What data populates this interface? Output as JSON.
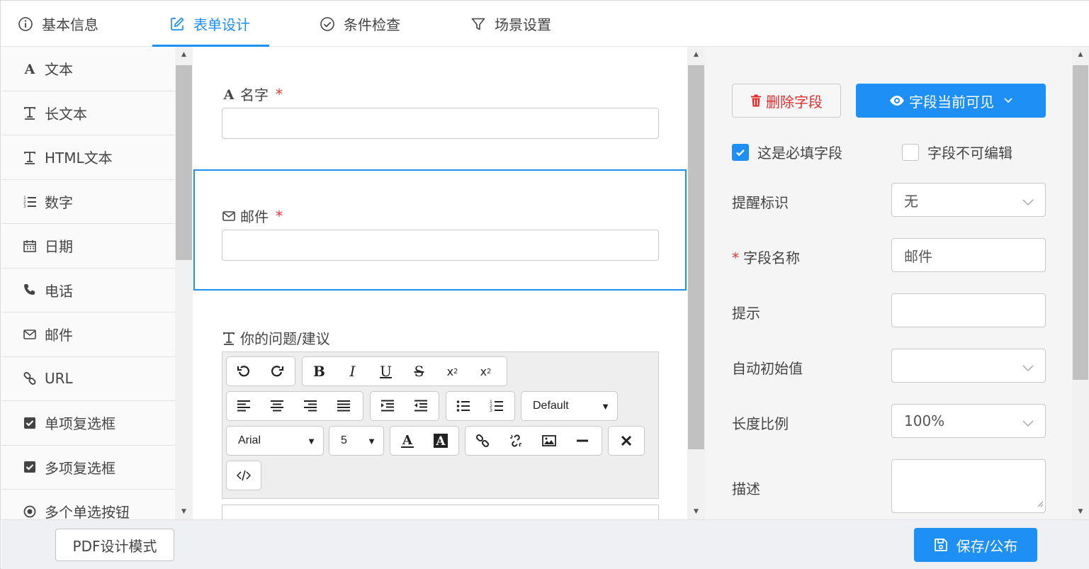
{
  "tabs": [
    {
      "label": "基本信息",
      "icon": "info-circle-icon"
    },
    {
      "label": "表单设计",
      "icon": "edit-icon",
      "active": true
    },
    {
      "label": "条件检查",
      "icon": "check-circle-icon"
    },
    {
      "label": "场景设置",
      "icon": "filter-icon"
    }
  ],
  "palette": {
    "items": [
      {
        "label": "文本",
        "icon": "font-a-icon"
      },
      {
        "label": "长文本",
        "icon": "text-t-icon"
      },
      {
        "label": "HTML文本",
        "icon": "text-t-icon"
      },
      {
        "label": "数字",
        "icon": "ordered-list-icon"
      },
      {
        "label": "日期",
        "icon": "calendar-icon"
      },
      {
        "label": "电话",
        "icon": "phone-icon"
      },
      {
        "label": "邮件",
        "icon": "envelope-icon"
      },
      {
        "label": "URL",
        "icon": "link-icon"
      },
      {
        "label": "单项复选框",
        "icon": "checkbox-icon"
      },
      {
        "label": "多项复选框",
        "icon": "checkbox-icon"
      },
      {
        "label": "多个单选按钮",
        "icon": "radio-icon"
      }
    ]
  },
  "canvas": {
    "fields": [
      {
        "label": "名字",
        "required": "*",
        "icon": "font-a-icon",
        "value": ""
      },
      {
        "label": "邮件",
        "required": "*",
        "icon": "envelope-icon",
        "value": ""
      },
      {
        "label": "你的问题/建议",
        "icon": "text-t-icon"
      }
    ],
    "editor": {
      "format_select": "Default",
      "font_select": "Arial",
      "size_select": "5"
    }
  },
  "props": {
    "delete_label": "删除字段",
    "visibility_label": "字段当前可见",
    "required_checkbox": "这是必填字段",
    "readonly_checkbox": "字段不可编辑",
    "reminder_label": "提醒标识",
    "reminder_value": "无",
    "required_mark": "*",
    "name_label": "字段名称",
    "name_value": "邮件",
    "hint_label": "提示",
    "hint_value": "",
    "auto_label": "自动初始值",
    "auto_value": "",
    "ratio_label": "长度比例",
    "ratio_value": "100%",
    "desc_label": "描述"
  },
  "footer": {
    "pdf_button": "PDF设计模式",
    "save_button": "保存/公布"
  },
  "colors": {
    "accent": "#1e8ff5",
    "danger": "#e02d2d"
  }
}
